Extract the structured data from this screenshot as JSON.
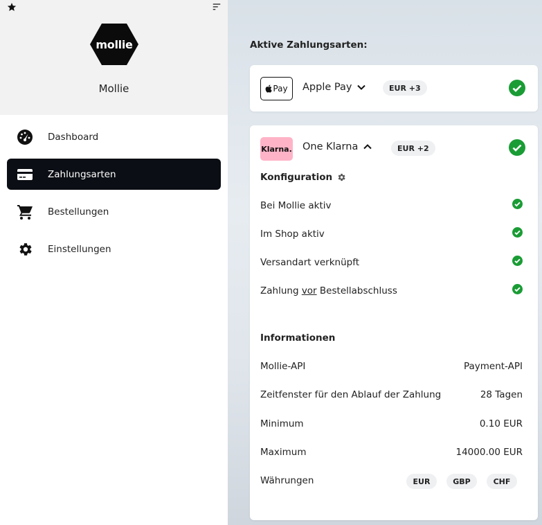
{
  "sidebar": {
    "brand": {
      "logo_text": "mollie",
      "name": "Mollie"
    },
    "nav": [
      {
        "label": "Dashboard",
        "icon": "dashboard-gauge-icon",
        "active": false
      },
      {
        "label": "Zahlungsarten",
        "icon": "credit-card-icon",
        "active": true
      },
      {
        "label": "Bestellungen",
        "icon": "shopping-cart-icon",
        "active": false
      },
      {
        "label": "Einstellungen",
        "icon": "gear-icon",
        "active": false
      }
    ]
  },
  "main": {
    "section_title": "Aktive Zahlungsarten:",
    "apple_pay": {
      "logo": "Pay",
      "name": "Apple Pay",
      "currency_badge": "EUR +3",
      "status": "active"
    },
    "klarna": {
      "logo": "Klarna.",
      "name": "One Klarna",
      "currency_badge": "EUR +2",
      "status": "active",
      "config_title": "Konfiguration",
      "config_rows": {
        "mollie_active": "Bei Mollie aktiv",
        "shop_active": "Im Shop aktiv",
        "shipping_linked": "Versandart verknüpft",
        "payment_prefix": "Zahlung",
        "payment_underlined": "vor",
        "payment_suffix": "Bestellabschluss"
      },
      "info_title": "Informationen",
      "info_rows": [
        {
          "label": "Mollie-API",
          "value": "Payment-API"
        },
        {
          "label": "Zeitfenster für den Ablauf der Zahlung",
          "value": "28 Tagen"
        },
        {
          "label": "Minimum",
          "value": "0.10 EUR"
        },
        {
          "label": "Maximum",
          "value": "14000.00 EUR"
        }
      ],
      "currencies_label": "Währungen",
      "currencies": [
        "EUR",
        "GBP",
        "CHF"
      ]
    }
  },
  "colors": {
    "active_nav_bg": "#0b0e14",
    "check_green": "#1a9c35",
    "klarna_pink": "#ffb3c7"
  }
}
